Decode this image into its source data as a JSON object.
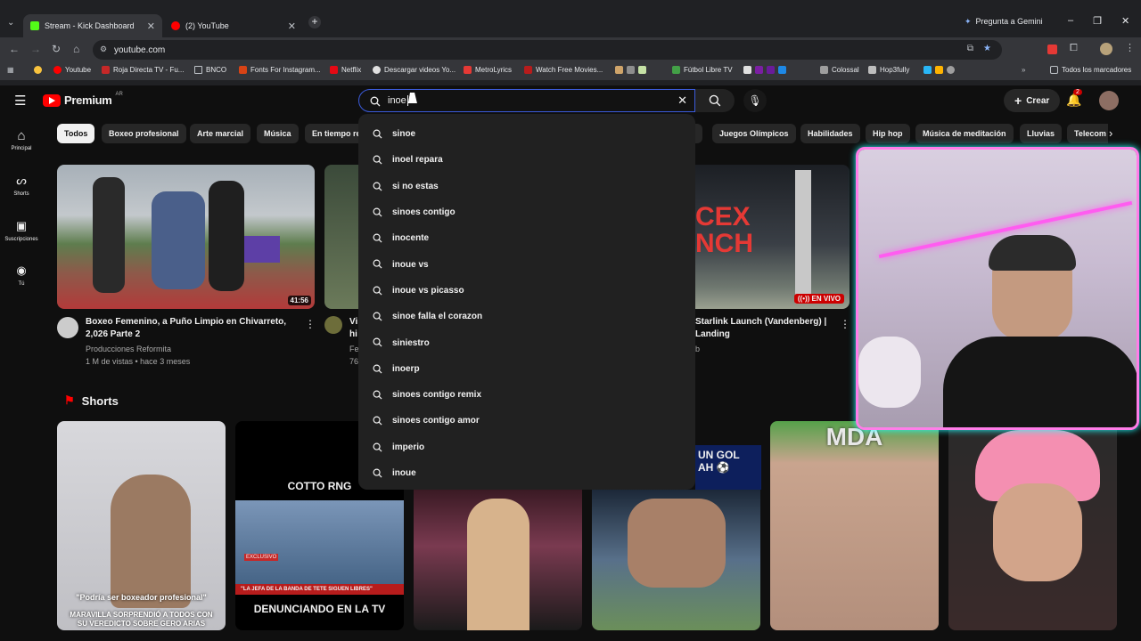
{
  "browser": {
    "tabs": [
      {
        "title": "Stream - Kick Dashboard",
        "color": "#53fc18",
        "active": true
      },
      {
        "title": "(2) YouTube",
        "color": "#ff0000",
        "active": false
      }
    ],
    "gemini_label": "Pregunta a Gemini",
    "url": "youtube.com",
    "bookmarks": [
      "Youtube",
      "Roja Directa TV - Fu...",
      "BNCO",
      "Fonts For Instagram...",
      "Netflix",
      "Descargar videos Yo...",
      "MetroLyrics",
      "Watch Free Movies...",
      "Fútbol Libre TV",
      "Colossal",
      "Hop3fully"
    ],
    "all_bookmarks_label": "Todos los marcadores"
  },
  "youtube": {
    "logo": "Premium",
    "region": "AR",
    "search_query": "inoe",
    "create_label": "Crear",
    "notification_count": "2",
    "sidebar": [
      {
        "label": "Principal",
        "icon": "home-icon"
      },
      {
        "label": "Shorts",
        "icon": "shorts-icon"
      },
      {
        "label": "Suscripciones",
        "icon": "subscriptions-icon"
      },
      {
        "label": "Tú",
        "icon": "you-icon"
      }
    ],
    "chips": [
      "Todos",
      "Boxeo profesional",
      "Arte marcial",
      "Música",
      "En tiempo re",
      "Juegos Olímpicos",
      "Habilidades",
      "Hip hop",
      "Música de meditación",
      "Lluvias",
      "Telecom"
    ],
    "suggestions": [
      "sinoe",
      "inoel repara",
      "si no estas",
      "sinoes contigo",
      "inocente",
      "inoue vs",
      "inoue vs picasso",
      "sinoe falla el corazon",
      "siniestro",
      "inoerp",
      "sinoes contigo remix",
      "sinoes contigo amor",
      "imperio",
      "inoue"
    ],
    "videos": [
      {
        "title": "Boxeo Femenino, a Puño Limpio en Chivarreto, 2,026  Parte 2",
        "channel": "Producciones Reformita",
        "meta": "1 M de vistas • hace 3 meses",
        "duration": "41:56"
      },
      {
        "title_partial": "Vi\nhi",
        "channel_partial": "Fe",
        "meta_partial": "76"
      },
      {
        "title": "Starlink Launch (Vandenberg) |\nLanding",
        "channel_partial": "b",
        "live_label": "EN VIVO",
        "thumb_text": "CEX\nNCH"
      }
    ],
    "shorts_heading": "Shorts",
    "shorts": [
      {
        "caption": "\"Podría ser boxeador profesional\"",
        "caption2": "MARAVILLA SORPRENDIÓ A TODOS CON SU VEREDICTO SOBRE GERO ARIAS"
      },
      {
        "top": "COTTO RNG",
        "banner": "\"LA JEFA DE LA BANDA DE TETE SIGUEN LIBRES\"",
        "tag": "EXCLUSIVO",
        "caption": "DENUNCIANDO EN LA TV"
      },
      {},
      {
        "top": "UN GOL\nAH ⚽"
      },
      {
        "top": "MDA"
      },
      {}
    ]
  }
}
